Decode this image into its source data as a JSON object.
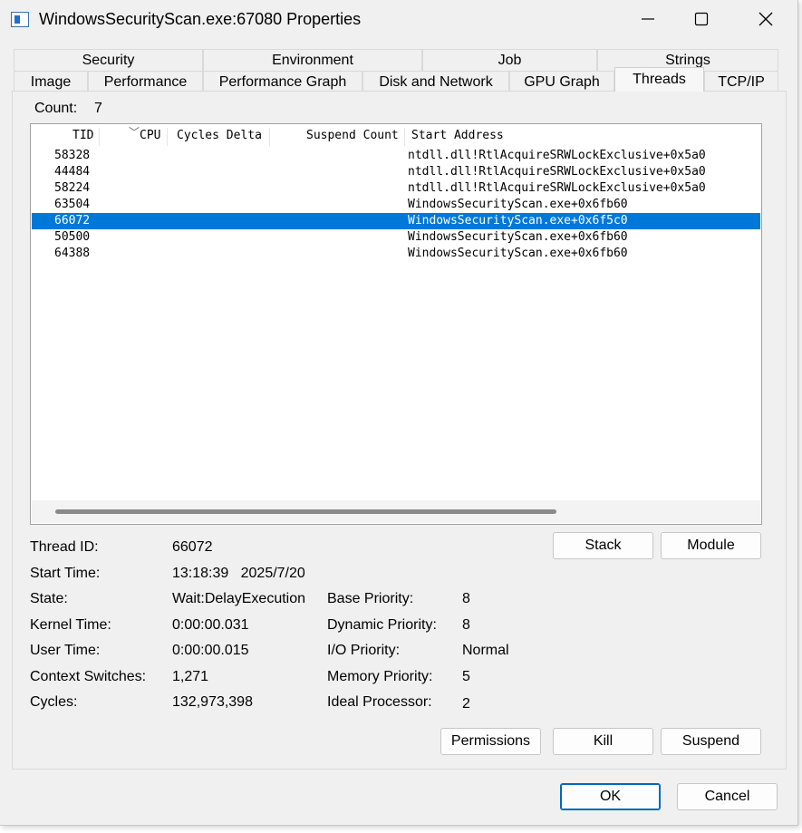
{
  "window": {
    "title": "WindowsSecurityScan.exe:67080 Properties"
  },
  "tabs_row1": [
    "Security",
    "Environment",
    "Job",
    "Strings"
  ],
  "tabs_row2": [
    "Image",
    "Performance",
    "Performance Graph",
    "Disk and Network",
    "GPU Graph",
    "Threads",
    "TCP/IP"
  ],
  "active_tab": "Threads",
  "count": {
    "label": "Count:",
    "value": "7"
  },
  "threads_table": {
    "columns": [
      "TID",
      "CPU",
      "Cycles Delta",
      "Suspend Count",
      "Start Address"
    ],
    "rows": [
      {
        "tid": "58328",
        "start_address": "ntdll.dll!RtlAcquireSRWLockExclusive+0x5a0"
      },
      {
        "tid": "44484",
        "start_address": "ntdll.dll!RtlAcquireSRWLockExclusive+0x5a0"
      },
      {
        "tid": "58224",
        "start_address": "ntdll.dll!RtlAcquireSRWLockExclusive+0x5a0"
      },
      {
        "tid": "63504",
        "start_address": "WindowsSecurityScan.exe+0x6fb60"
      },
      {
        "tid": "66072",
        "start_address": "WindowsSecurityScan.exe+0x6f5c0"
      },
      {
        "tid": "50500",
        "start_address": "WindowsSecurityScan.exe+0x6fb60"
      },
      {
        "tid": "64388",
        "start_address": "WindowsSecurityScan.exe+0x6fb60"
      }
    ],
    "selected_tid": "66072"
  },
  "details": {
    "thread_id_label": "Thread ID:",
    "thread_id": "66072",
    "start_time_label": "Start Time:",
    "start_time": "13:18:39   2025/7/20",
    "state_label": "State:",
    "state": "Wait:DelayExecution",
    "kernel_time_label": "Kernel Time:",
    "kernel_time": "0:00:00.031",
    "user_time_label": "User Time:",
    "user_time": "0:00:00.015",
    "context_switches_label": "Context Switches:",
    "context_switches": "1,271",
    "cycles_label": "Cycles:",
    "cycles": "132,973,398",
    "base_priority_label": "Base Priority:",
    "base_priority": "8",
    "dynamic_priority_label": "Dynamic Priority:",
    "dynamic_priority": "8",
    "io_priority_label": "I/O Priority:",
    "io_priority": "Normal",
    "memory_priority_label": "Memory Priority:",
    "memory_priority": "5",
    "ideal_processor_label": "Ideal Processor:",
    "ideal_processor": "2"
  },
  "buttons": {
    "stack": "Stack",
    "module": "Module",
    "permissions": "Permissions",
    "kill": "Kill",
    "suspend": "Suspend",
    "ok": "OK",
    "cancel": "Cancel"
  },
  "icons": {
    "app": "process-window-icon",
    "minimize": "minimize-icon",
    "maximize": "maximize-icon",
    "close": "close-icon",
    "sort": "sort-descending-icon"
  },
  "colors": {
    "selection": "#0078d7",
    "default_button_border": "#0067c0"
  }
}
